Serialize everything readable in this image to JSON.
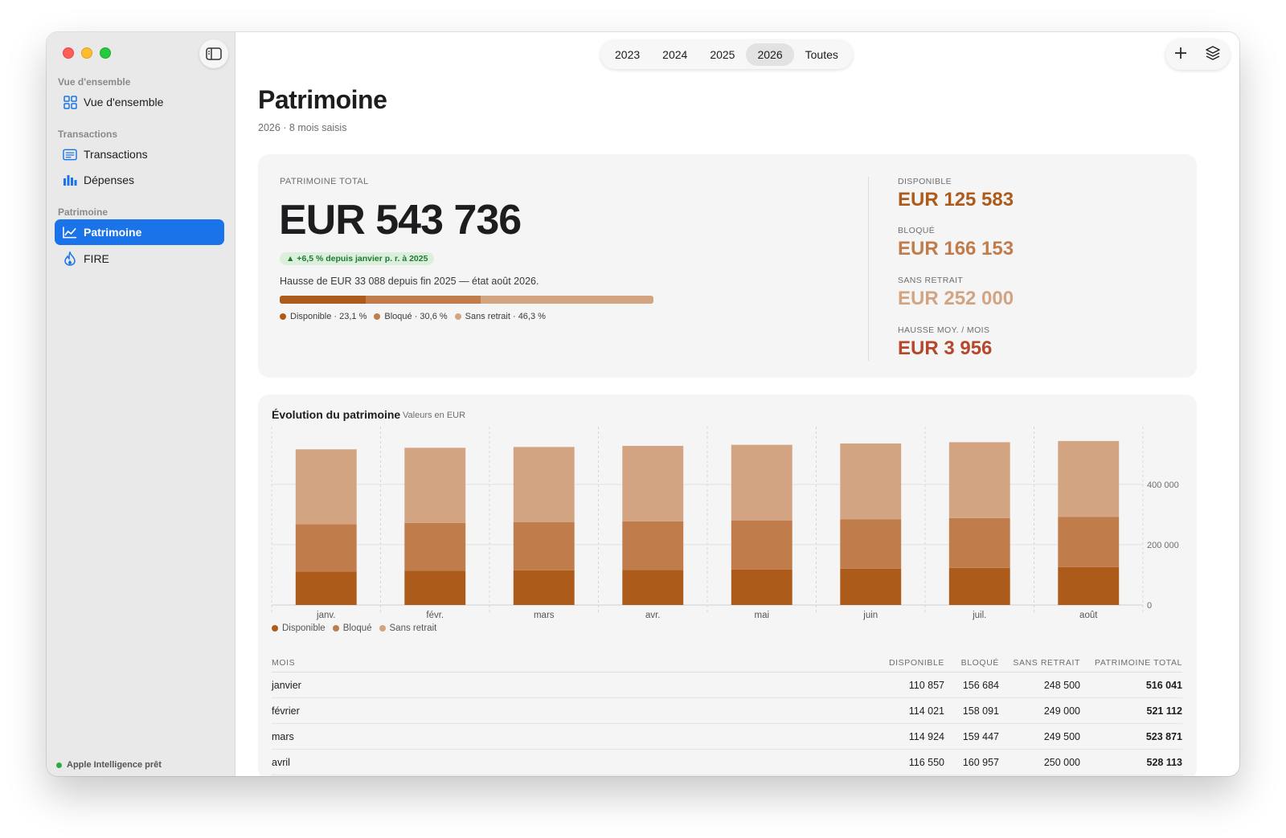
{
  "sidebar": {
    "sections": [
      {
        "label": "Vue d'ensemble",
        "items": [
          {
            "label": "Vue d'ensemble",
            "icon": "grid-icon"
          }
        ]
      },
      {
        "label": "Transactions",
        "items": [
          {
            "label": "Transactions",
            "icon": "list-icon"
          },
          {
            "label": "Dépenses",
            "icon": "bar-chart-icon"
          }
        ]
      },
      {
        "label": "Patrimoine",
        "items": [
          {
            "label": "Patrimoine",
            "icon": "trend-chart-icon"
          },
          {
            "label": "FIRE",
            "icon": "flame-icon"
          }
        ]
      }
    ],
    "active": "Patrimoine",
    "status": "Apple Intelligence prêt"
  },
  "toolbar": {
    "years": [
      "2023",
      "2024",
      "2025",
      "2026",
      "Toutes"
    ],
    "selected_year": "2026"
  },
  "page": {
    "title": "Patrimoine",
    "subtitle": "2026 · 8 mois saisis"
  },
  "summary": {
    "label": "PATRIMOINE TOTAL",
    "total": "EUR 543 736",
    "badge": "▲ +6,5 % depuis janvier p. r. à 2025",
    "description": "Hausse de EUR 33 088 depuis fin 2025 — état août 2026.",
    "split": [
      {
        "label": "Disponible · 23,1 %",
        "pct": 23.1,
        "color": "#ad5b1a"
      },
      {
        "label": "Bloqué · 30,6 %",
        "pct": 30.6,
        "color": "#c17c4b"
      },
      {
        "label": "Sans retrait · 46,3 %",
        "pct": 46.3,
        "color": "#d3a482"
      }
    ],
    "stats": [
      {
        "label": "DISPONIBLE",
        "value": "EUR 125 583",
        "color": "#ad5b1a"
      },
      {
        "label": "BLOQUÉ",
        "value": "EUR 166 153",
        "color": "#c17c4b"
      },
      {
        "label": "SANS RETRAIT",
        "value": "EUR 252 000",
        "color": "#d3a482"
      },
      {
        "label": "HAUSSE MOY. / MOIS",
        "value": "EUR 3 956",
        "color": "#b7472a"
      }
    ]
  },
  "chart": {
    "title": "Évolution du patrimoine",
    "subtitle": "Valeurs en EUR"
  },
  "chart_data": {
    "type": "bar",
    "stacked": true,
    "categories": [
      "janv.",
      "févr.",
      "mars",
      "avr.",
      "mai",
      "juin",
      "juil.",
      "août"
    ],
    "series": [
      {
        "name": "Disponible",
        "color": "#ad5b1a",
        "values": [
          110857,
          114021,
          114924,
          116500,
          118000,
          120500,
          123000,
          125583
        ]
      },
      {
        "name": "Bloqué",
        "color": "#c17c4b",
        "values": [
          156684,
          158091,
          159447,
          161000,
          162500,
          164000,
          165200,
          166153
        ]
      },
      {
        "name": "Sans retrait",
        "color": "#d3a482",
        "values": [
          248500,
          249000,
          249500,
          250000,
          250500,
          251000,
          251500,
          252000
        ]
      }
    ],
    "y_ticks": [
      0,
      200000,
      400000
    ],
    "y_tick_labels": [
      "0",
      "200 000",
      "400 000"
    ],
    "ylim": [
      0,
      570000
    ],
    "grid": true,
    "legend_position": "bottom-left"
  },
  "table": {
    "headers": [
      "MOIS",
      "DISPONIBLE",
      "BLOQUÉ",
      "SANS RETRAIT",
      "PATRIMOINE TOTAL"
    ],
    "rows": [
      {
        "mois": "janvier",
        "disponible": "110 857",
        "bloque": "156 684",
        "sans_retrait": "248 500",
        "total": "516 041"
      },
      {
        "mois": "février",
        "disponible": "114 021",
        "bloque": "158 091",
        "sans_retrait": "249 000",
        "total": "521 112"
      },
      {
        "mois": "mars",
        "disponible": "114 924",
        "bloque": "159 447",
        "sans_retrait": "249 500",
        "total": "523 871"
      },
      {
        "mois": "avril",
        "disponible": "116 550",
        "bloque": "160 957",
        "sans_retrait": "250 000",
        "total": "528 113"
      }
    ]
  }
}
